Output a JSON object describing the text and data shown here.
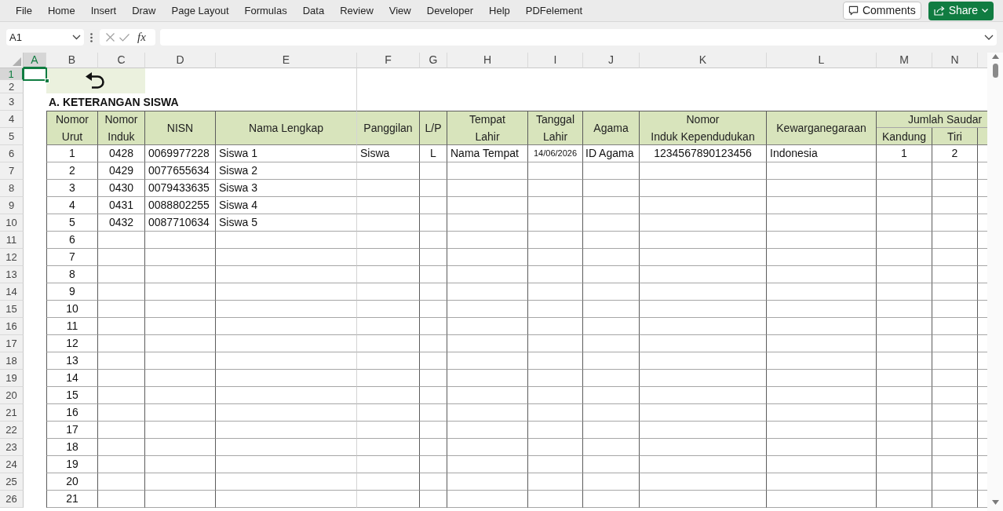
{
  "ribbon_tabs": [
    {
      "label": "File",
      "selected": false
    },
    {
      "label": "Home",
      "selected": false
    },
    {
      "label": "Insert",
      "selected": false
    },
    {
      "label": "Draw",
      "selected": false
    },
    {
      "label": "Page Layout",
      "selected": false
    },
    {
      "label": "Formulas",
      "selected": false
    },
    {
      "label": "Data",
      "selected": false
    },
    {
      "label": "Review",
      "selected": false
    },
    {
      "label": "View",
      "selected": false
    },
    {
      "label": "Developer",
      "selected": false
    },
    {
      "label": "Help",
      "selected": false
    },
    {
      "label": "PDFelement",
      "selected": false
    }
  ],
  "header_buttons": [
    {
      "kind": "comments",
      "label": "Comments"
    },
    {
      "kind": "share",
      "label": "Share"
    }
  ],
  "formula_bar": {
    "name_box": "A1",
    "function_button": "fx"
  },
  "sheet": {
    "column_headers": [
      {
        "label": "A",
        "selected": true
      },
      {
        "label": "B",
        "selected": false
      },
      {
        "label": "C",
        "selected": false
      },
      {
        "label": "D",
        "selected": false
      },
      {
        "label": "E",
        "selected": false
      },
      {
        "label": "F",
        "selected": false
      },
      {
        "label": "G",
        "selected": false
      },
      {
        "label": "H",
        "selected": false
      },
      {
        "label": "I",
        "selected": false
      },
      {
        "label": "J",
        "selected": false
      },
      {
        "label": "K",
        "selected": false
      },
      {
        "label": "L",
        "selected": false
      },
      {
        "label": "M",
        "selected": false
      },
      {
        "label": "N",
        "selected": false
      }
    ],
    "row_headers": [
      {
        "label": "1",
        "selected": true
      },
      {
        "label": "2",
        "selected": false
      },
      {
        "label": "3",
        "selected": false
      },
      {
        "label": "4",
        "selected": false
      },
      {
        "label": "5",
        "selected": false
      },
      {
        "label": "6",
        "selected": false
      },
      {
        "label": "7",
        "selected": false
      },
      {
        "label": "8",
        "selected": false
      },
      {
        "label": "9",
        "selected": false
      },
      {
        "label": "10",
        "selected": false
      },
      {
        "label": "11",
        "selected": false
      },
      {
        "label": "12",
        "selected": false
      },
      {
        "label": "13",
        "selected": false
      },
      {
        "label": "14",
        "selected": false
      },
      {
        "label": "15",
        "selected": false
      },
      {
        "label": "16",
        "selected": false
      },
      {
        "label": "17",
        "selected": false
      },
      {
        "label": "18",
        "selected": false
      },
      {
        "label": "19",
        "selected": false
      },
      {
        "label": "20",
        "selected": false
      },
      {
        "label": "21",
        "selected": false
      },
      {
        "label": "22",
        "selected": false
      },
      {
        "label": "23",
        "selected": false
      },
      {
        "label": "24",
        "selected": false
      },
      {
        "label": "25",
        "selected": false
      },
      {
        "label": "26",
        "selected": false
      }
    ],
    "title": "A. KETERANGAN SISWA",
    "table": {
      "columns": [
        "Nomor\nUrut",
        "Nomor\nInduk",
        "NISN",
        "Nama Lengkap",
        "Panggilan",
        "L/P",
        "Tempat\nLahir",
        "Tanggal\nLahir",
        "Agama",
        "Nomor\nInduk Kependudukan",
        "Kewarganegaraan"
      ],
      "column_group": {
        "label": "Jumlah Saudar",
        "columns": [
          "Kandung",
          "Tiri"
        ]
      },
      "rows": [
        [
          "1",
          "0428",
          "0069977228",
          "Siswa 1",
          "Siswa",
          "L",
          "Nama Tempat",
          "14/06/2026",
          "ID Agama",
          "1234567890123456",
          "Indonesia",
          "1",
          "2"
        ],
        [
          "2",
          "0429",
          "0077655634",
          "Siswa 2"
        ],
        [
          "3",
          "0430",
          "0079433635",
          "Siswa 3"
        ],
        [
          "4",
          "0431",
          "0088802255",
          "Siswa 4"
        ],
        [
          "5",
          "0432",
          "0087710634",
          "Siswa 5"
        ],
        [
          "6"
        ],
        [
          "7"
        ],
        [
          "8"
        ],
        [
          "9"
        ],
        [
          "10"
        ],
        [
          "11"
        ],
        [
          "12"
        ],
        [
          "13"
        ],
        [
          "14"
        ],
        [
          "15"
        ],
        [
          "16"
        ],
        [
          "17"
        ],
        [
          "18"
        ],
        [
          "19"
        ],
        [
          "20"
        ],
        [
          "21"
        ]
      ]
    }
  }
}
